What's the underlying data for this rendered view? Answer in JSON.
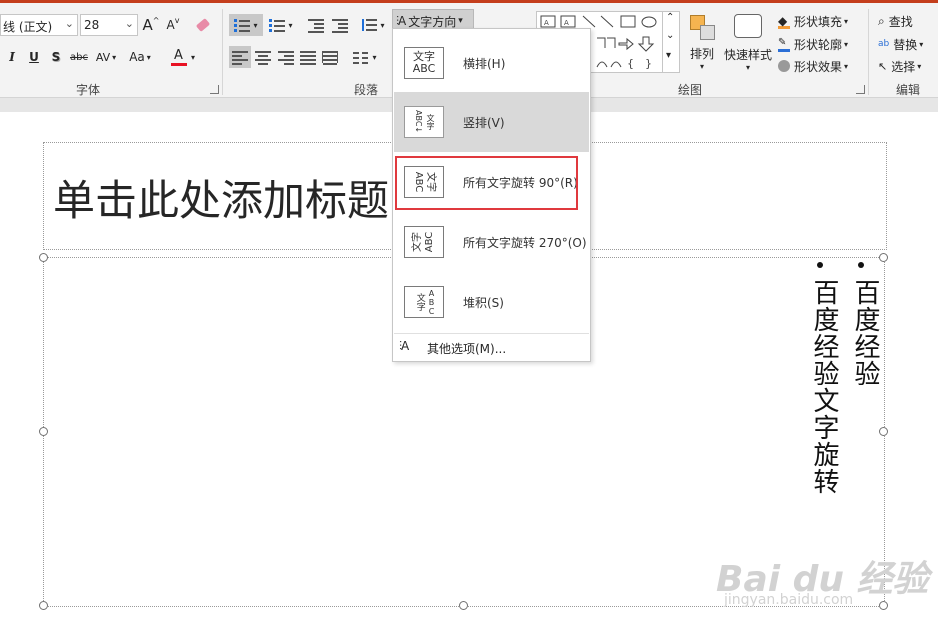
{
  "font": {
    "font_name": "线 (正文)",
    "font_size": "28",
    "grow": "A",
    "shrink": "A",
    "italic": "I",
    "underline": "U",
    "shadow": "S",
    "strike": "abc",
    "spacing": "AV",
    "case": "Aa",
    "color_letter": "A",
    "group_label": "字体"
  },
  "paragraph": {
    "group_label": "段落"
  },
  "text_direction": {
    "button_label": "文字方向",
    "arrow": "▾"
  },
  "menu": {
    "items": [
      {
        "label": "横排(H)",
        "icon_text": "文字\nABC"
      },
      {
        "label": "竖排(V)",
        "icon_text": "文字ABC"
      },
      {
        "label": "所有文字旋转 90°(R)",
        "icon_text": "文字ABC"
      },
      {
        "label": "所有文字旋转 270°(O)",
        "icon_text": "文字ABC"
      },
      {
        "label": "堆积(S)",
        "icon_text": "文字ABC"
      }
    ],
    "more": "其他选项(M)..."
  },
  "drawing": {
    "group_label": "绘图",
    "arrange": "排列",
    "quick_styles": "快速样式",
    "shape_fill": "形状填充",
    "shape_outline": "形状轮廓",
    "shape_effects": "形状效果"
  },
  "editing": {
    "group_label": "编辑",
    "find": "查找",
    "replace": "替换",
    "select": "选择"
  },
  "slide": {
    "title_placeholder": "单击此处添加标题",
    "col1": "百度经验",
    "col2": "百度经验文字旋转"
  },
  "watermark": {
    "logo": "Bai du 经验",
    "url": "jingyan.baidu.com"
  },
  "colors": {
    "accent_red": "#e0393e",
    "ribbon_top": "#c43e1c",
    "font_color_bar": "#e81123"
  }
}
